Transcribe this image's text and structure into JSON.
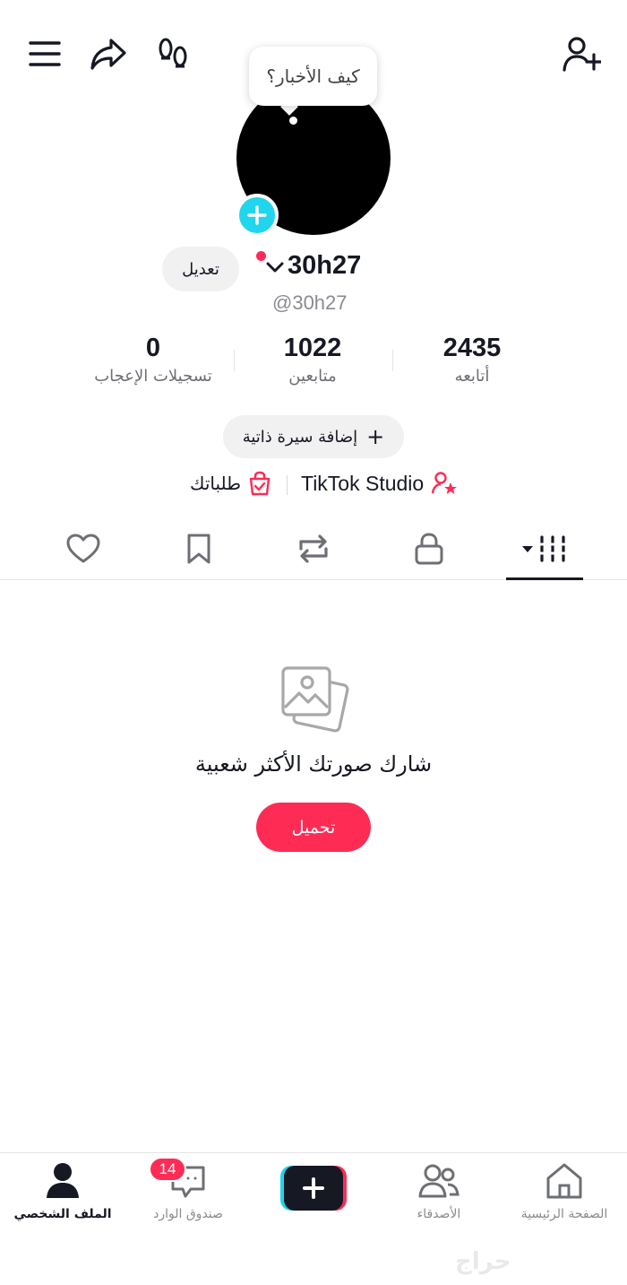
{
  "header": {
    "menu_icon": "hamburger-menu-icon",
    "share_icon": "share-arrow-icon",
    "footprints_icon": "footprints-icon",
    "add_friend_icon": "add-user-icon"
  },
  "avatar": {
    "bubble_text": "كيف الأخبار؟"
  },
  "profile": {
    "edit_label": "تعديل",
    "username": "30h27",
    "handle": "@30h27"
  },
  "stats": {
    "likes": {
      "value": "0",
      "label": "تسجيلات الإعجاب"
    },
    "followers": {
      "value": "1022",
      "label": "متابعين"
    },
    "following": {
      "value": "2435",
      "label": "أتابعه"
    }
  },
  "bio": {
    "add_label": "إضافة سيرة ذاتية",
    "plus": "+"
  },
  "links": {
    "studio_label": "TikTok Studio",
    "orders_label": "طلباتك"
  },
  "tabs": [
    {
      "icon": "videos-grid-icon",
      "active": true
    },
    {
      "icon": "lock-icon",
      "active": false
    },
    {
      "icon": "repost-icon",
      "active": false
    },
    {
      "icon": "bookmark-icon",
      "active": false
    },
    {
      "icon": "heart-icon",
      "active": false
    }
  ],
  "empty_state": {
    "icon": "photos-icon",
    "title": "شارك صورتك الأكثر شعبية",
    "button_label": "تحميل"
  },
  "bottom_nav": {
    "profile": "الملف الشخصي",
    "inbox": "صندوق الوارد",
    "inbox_badge": "14",
    "friends": "الأصدقاء",
    "home": "الصفحة الرئيسية"
  },
  "watermark": "حراج",
  "colors": {
    "accent": "#fe2c55",
    "cyan": "#20d5ec",
    "text": "#161823",
    "muted": "#8a8b91"
  }
}
